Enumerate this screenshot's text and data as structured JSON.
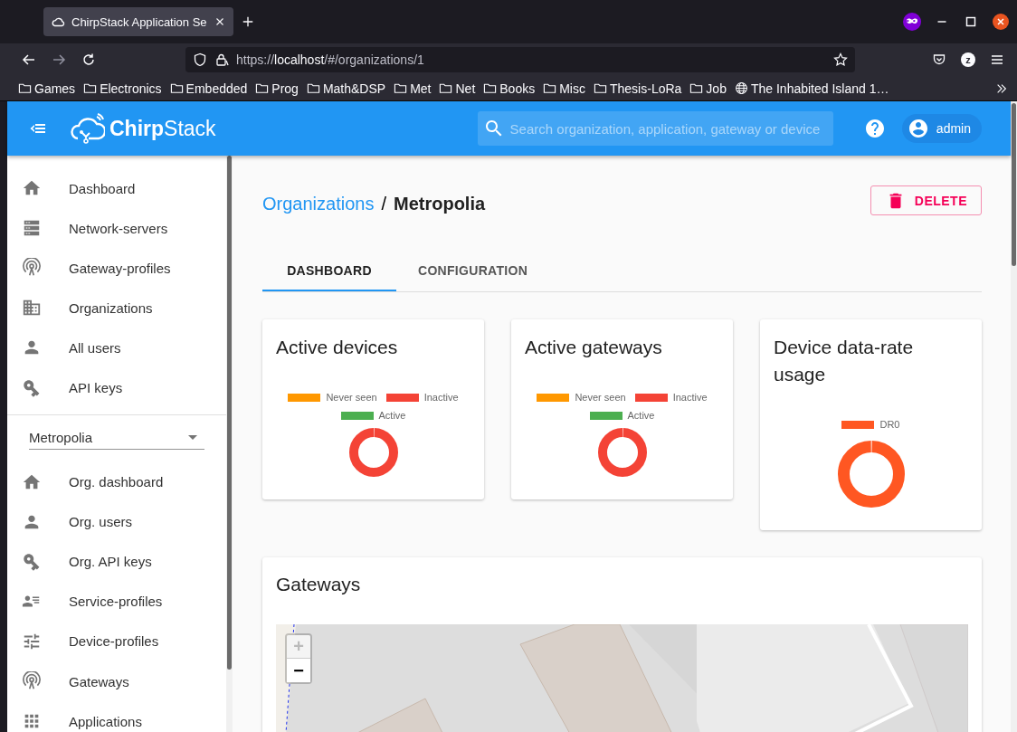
{
  "browser": {
    "tab_title": "ChirpStack Application Se",
    "url_scheme": "https://",
    "url_host": "localhost",
    "url_path": "/#/organizations/1",
    "profile_initial": "z",
    "forward_disabled": true,
    "bookmarks": [
      {
        "label": "Games",
        "kind": "folder"
      },
      {
        "label": "Electronics",
        "kind": "folder"
      },
      {
        "label": "Embedded",
        "kind": "folder"
      },
      {
        "label": "Prog",
        "kind": "folder"
      },
      {
        "label": "Math&DSP",
        "kind": "folder"
      },
      {
        "label": "Met",
        "kind": "folder"
      },
      {
        "label": "Net",
        "kind": "folder"
      },
      {
        "label": "Books",
        "kind": "folder"
      },
      {
        "label": "Misc",
        "kind": "folder"
      },
      {
        "label": "Thesis-LoRa",
        "kind": "folder"
      },
      {
        "label": "Job",
        "kind": "folder"
      },
      {
        "label": "The Inhabited Island 1…",
        "kind": "page"
      }
    ]
  },
  "app_bar": {
    "brand": "**Chirp**Stack",
    "search": {
      "placeholder": "Search organization, application, gateway or device"
    },
    "user": "admin"
  },
  "sidebar": {
    "items": [
      {
        "label": "Dashboard",
        "selected": false
      },
      {
        "label": "Network-servers",
        "selected": false
      },
      {
        "label": "Gateway-profiles",
        "selected": false
      },
      {
        "label": "Organizations",
        "selected": false
      },
      {
        "label": "All users",
        "selected": false
      },
      {
        "label": "API keys",
        "selected": false
      }
    ],
    "organization_select": {
      "value": "Metropolia"
    },
    "org_items": [
      {
        "label": "Org. dashboard",
        "selected": false
      },
      {
        "label": "Org. users",
        "selected": false
      },
      {
        "label": "Org. API keys",
        "selected": false
      },
      {
        "label": "Service-profiles",
        "selected": false
      },
      {
        "label": "Device-profiles",
        "selected": false
      },
      {
        "label": "Gateways",
        "selected": false
      },
      {
        "label": "Applications",
        "selected": false
      }
    ]
  },
  "breadcrumb": {
    "parent": "Organizations",
    "separator": "/",
    "current": "Metropolia"
  },
  "delete_button": "DELETE",
  "tabs": [
    {
      "label": "DASHBOARD",
      "selected": true
    },
    {
      "label": "CONFIGURATION",
      "selected": false
    }
  ],
  "cards": [
    {
      "title": "Active devices",
      "legend": [
        {
          "label": "Never seen",
          "color": "#ff9800",
          "fills_donut": false
        },
        {
          "label": "Inactive",
          "color": "#f44336",
          "fills_donut": true
        },
        {
          "label": "Active",
          "color": "#4caf50",
          "fills_donut": false
        }
      ]
    },
    {
      "title": "Active gateways",
      "legend": [
        {
          "label": "Never seen",
          "color": "#ff9800",
          "fills_donut": false
        },
        {
          "label": "Inactive",
          "color": "#f44336",
          "fills_donut": true
        },
        {
          "label": "Active",
          "color": "#4caf50",
          "fills_donut": false
        }
      ]
    },
    {
      "title": "Device data-rate usage",
      "legend": [
        {
          "label": "DR0",
          "color": "#ff5722",
          "fills_donut": true
        }
      ]
    }
  ],
  "gateways": {
    "title": "Gateways",
    "map": {
      "kind": "picture",
      "zoom_in": {
        "label": "+",
        "disabled": true
      },
      "zoom_out": {
        "label": "−",
        "disabled": false
      }
    }
  }
}
